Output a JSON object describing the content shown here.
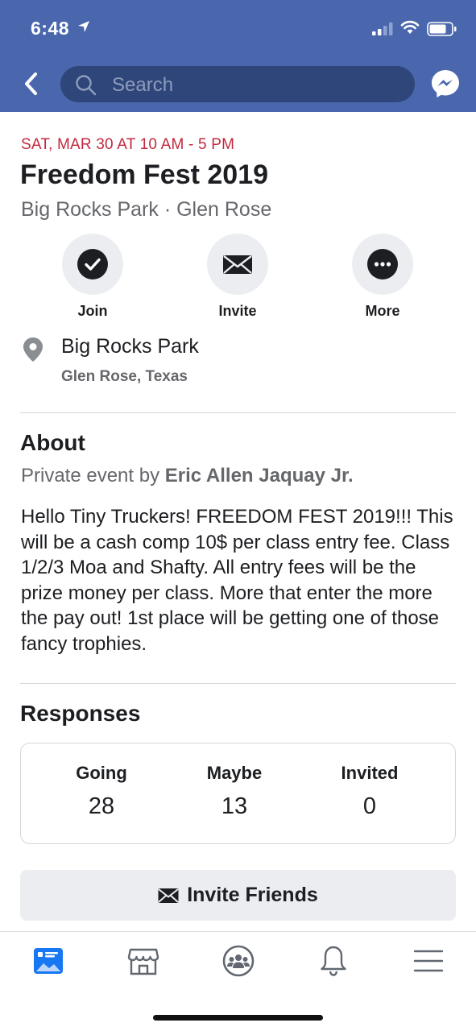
{
  "status_bar": {
    "time": "6:48",
    "icons": [
      "location-arrow-icon",
      "cellular-signal-icon",
      "wifi-icon",
      "battery-icon"
    ]
  },
  "nav": {
    "back_icon": "chevron-left-icon",
    "search_placeholder": "Search",
    "messenger_icon": "messenger-icon",
    "header_color": "#4a67ad"
  },
  "event": {
    "date": "SAT, MAR 30 AT 10 AM - 5 PM",
    "title": "Freedom Fest 2019",
    "venue": "Big Rocks Park · Glen Rose",
    "date_color": "#c3283e"
  },
  "actions": [
    {
      "label": "Join",
      "icon": "checkmark-icon"
    },
    {
      "label": "Invite",
      "icon": "envelope-icon"
    },
    {
      "label": "More",
      "icon": "more-dots-icon"
    }
  ],
  "location": {
    "name": "Big Rocks Park",
    "city": "Glen Rose, Texas",
    "icon": "map-pin-icon"
  },
  "about": {
    "title": "About",
    "host_prefix": "Private event by ",
    "host_name": "Eric Allen Jaquay Jr.",
    "description": "Hello Tiny Truckers! FREEDOM FEST 2019!!! This will be a cash comp 10$ per class entry fee. Class 1/2/3 Moa and Shafty. All entry fees will be the prize money per class. More that enter the more the pay out! 1st place will be getting one of those fancy trophies."
  },
  "responses": {
    "title": "Responses",
    "items": [
      {
        "label": "Going",
        "count": "28"
      },
      {
        "label": "Maybe",
        "count": "13"
      },
      {
        "label": "Invited",
        "count": "0"
      }
    ]
  },
  "invite_button": {
    "label": "Invite Friends",
    "icon": "envelope-icon"
  },
  "tabbar": {
    "tabs": [
      "news-feed-icon",
      "marketplace-icon",
      "groups-icon",
      "notifications-bell-icon",
      "menu-icon"
    ],
    "active": "news-feed-icon",
    "active_color": "#1877f2"
  }
}
